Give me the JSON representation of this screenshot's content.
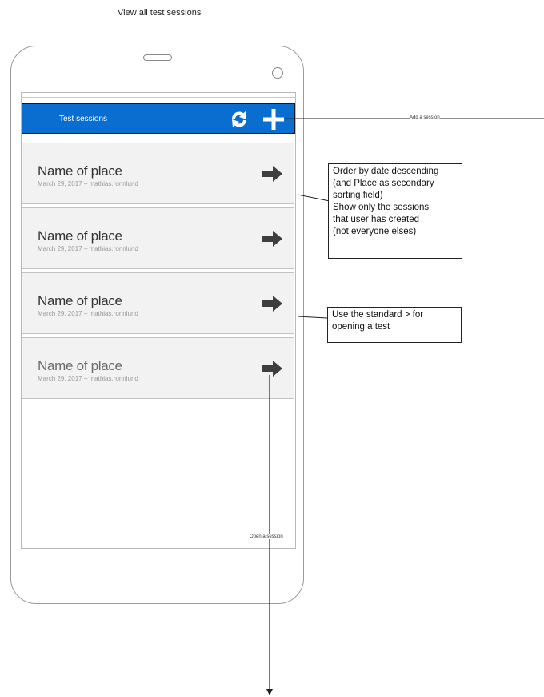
{
  "page": {
    "title": "View all test sessions"
  },
  "app": {
    "bar_title": "Test sessions",
    "refresh_icon": "refresh-icon",
    "add_icon": "plus-icon",
    "bar_color": "#0a6ed1"
  },
  "sessions": [
    {
      "place": "Name of place",
      "meta": "March 29, 2017 – mathias.ronnlund",
      "arrow_icon": "arrow-right-icon"
    },
    {
      "place": "Name of place",
      "meta": "March 29, 2017 – mathias.ronnlund",
      "arrow_icon": "arrow-right-icon"
    },
    {
      "place": "Name of place",
      "meta": "March 29, 2017 – mathias.ronnlund",
      "arrow_icon": "arrow-right-icon"
    },
    {
      "place": "Name of place",
      "meta": "March 29, 2017 – mathias.ronnlund",
      "arrow_icon": "arrow-right-icon"
    }
  ],
  "annotations": {
    "add_session": "Add a session",
    "open_session": "Open a session",
    "ordering": [
      "Order by date descending",
      "(and Place as secondary",
      "sorting field)",
      "Show only the sessions",
      "that user has created",
      "(not everyone elses)"
    ],
    "standard_arrow": [
      "Use the standard > for",
      "opening a test"
    ]
  }
}
